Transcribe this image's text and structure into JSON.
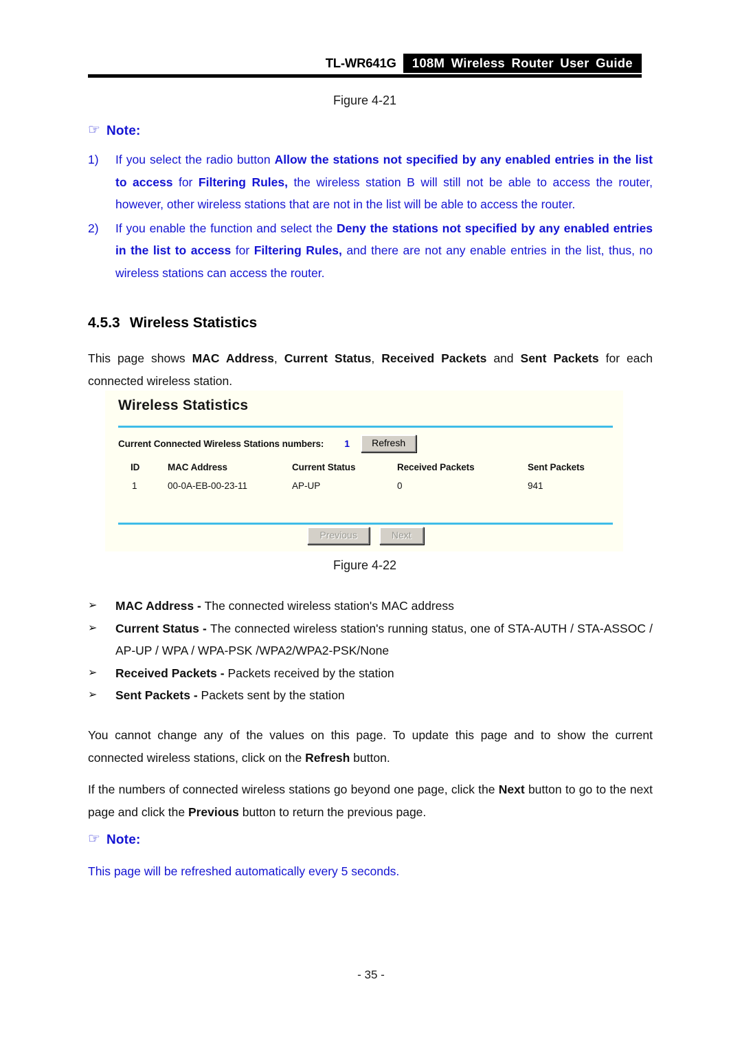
{
  "header": {
    "model": "TL-WR641G",
    "banner_title": "108M Wireless Router User Guide"
  },
  "figures": {
    "caption_top": "Figure 4-21",
    "caption_bottom": "Figure 4-22"
  },
  "note_top": {
    "icon": "pointing-hand-icon",
    "glyph": "☞",
    "label": "Note:",
    "color": "#1414d2",
    "items": [
      {
        "marker": "1)",
        "parts": [
          {
            "text": "If you select the radio button ",
            "bold": false
          },
          {
            "text": "Allow the stations not specified by any enabled entries in the list to access",
            "bold": true
          },
          {
            "text": " for ",
            "bold": false
          },
          {
            "text": "Filtering Rules,",
            "bold": true
          },
          {
            "text": " the wireless station B will still not be able to access the router, however, other wireless stations that are not in the list will be able to access the router.",
            "bold": false
          }
        ]
      },
      {
        "marker": "2)",
        "parts": [
          {
            "text": "If you enable the function and select the ",
            "bold": false
          },
          {
            "text": "Deny the stations not specified by any enabled entries in the list to access",
            "bold": true
          },
          {
            "text": " for ",
            "bold": false
          },
          {
            "text": "Filtering Rules,",
            "bold": true
          },
          {
            "text": " and there are not any enable entries in the list, thus, no wireless stations can access the router.",
            "bold": false
          }
        ]
      }
    ]
  },
  "section": {
    "number": "4.5.3",
    "title": "Wireless Statistics"
  },
  "intro_paragraph": {
    "parts": [
      {
        "text": "This page shows ",
        "bold": false
      },
      {
        "text": "MAC Address",
        "bold": true
      },
      {
        "text": ", ",
        "bold": false
      },
      {
        "text": "Current Status",
        "bold": true
      },
      {
        "text": ", ",
        "bold": false
      },
      {
        "text": "Received Packets",
        "bold": true
      },
      {
        "text": " and ",
        "bold": false
      },
      {
        "text": "Sent Packets",
        "bold": true
      },
      {
        "text": " for each connected wireless station.",
        "bold": false
      }
    ]
  },
  "router_panel": {
    "title": "Wireless Statistics",
    "background_color": "#fffff2",
    "rule_color": "#3fbce8",
    "count_label": "Current Connected Wireless Stations numbers:",
    "count_value": "1",
    "count_value_color": "#0a0ad0",
    "refresh_label": "Refresh",
    "columns": [
      "ID",
      "MAC Address",
      "Current Status",
      "Received Packets",
      "Sent Packets"
    ],
    "rows": [
      [
        "1",
        "00-0A-EB-00-23-11",
        "AP-UP",
        "0",
        "941"
      ]
    ],
    "previous_label": "Previous",
    "next_label": "Next",
    "pager_disabled": true
  },
  "bullets": {
    "marker": "➢",
    "items": [
      {
        "term": "MAC Address",
        "separator": " - ",
        "description": "The connected wireless station's MAC address"
      },
      {
        "term": "Current Status",
        "separator": " - ",
        "description": "The connected wireless station's running status, one of STA-AUTH / STA-ASSOC / AP-UP / WPA / WPA-PSK /WPA2/WPA2-PSK/None"
      },
      {
        "term": "Received Packets",
        "separator": " - ",
        "description": "Packets received by the station"
      },
      {
        "term": "Sent Packets",
        "separator": " - ",
        "description": "Packets sent by the station"
      }
    ]
  },
  "paragraph_refresh": {
    "parts": [
      {
        "text": "You cannot change any of the values on this page. To update this page and to show the current connected wireless stations, click on the ",
        "bold": false
      },
      {
        "text": "Refresh",
        "bold": true
      },
      {
        "text": " button.",
        "bold": false
      }
    ]
  },
  "paragraph_pager": {
    "parts": [
      {
        "text": "If the numbers of connected wireless stations go beyond one page, click the ",
        "bold": false
      },
      {
        "text": "Next",
        "bold": true
      },
      {
        "text": " button to go to the next page and click the ",
        "bold": false
      },
      {
        "text": "Previous",
        "bold": true
      },
      {
        "text": " button to return the previous page.",
        "bold": false
      }
    ]
  },
  "note_bottom": {
    "icon": "pointing-hand-icon",
    "glyph": "☞",
    "label": "Note:",
    "text": "This page will be refreshed automatically every 5 seconds."
  },
  "footer": {
    "page_number": "- 35 -"
  }
}
